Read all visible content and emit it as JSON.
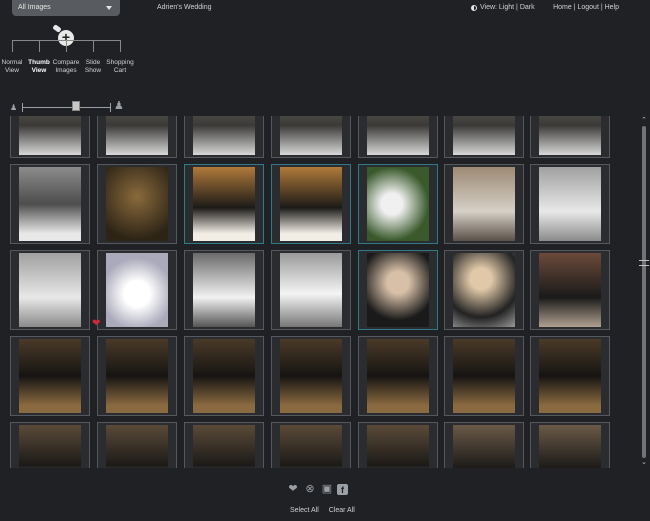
{
  "topbar": {
    "album_select": "All Images",
    "album_title": "Adrien's Wedding",
    "view_toggle": "View: Light | Dark",
    "links": "Home | Logout | Help"
  },
  "modes": [
    {
      "label": "Normal View",
      "active": false
    },
    {
      "label": "Thumb View",
      "active": true
    },
    {
      "label": "Compare Images",
      "active": false
    },
    {
      "label": "Slide Show",
      "active": false
    },
    {
      "label": "Shopping Cart",
      "active": false
    }
  ],
  "grid": {
    "rows": [
      [
        "partial",
        "partial",
        "partial",
        "partial",
        "partial",
        "partial",
        "partial"
      ],
      [
        "couple-church",
        "couple-indoor",
        "bride-bridesmaid",
        "bride-bridesmaid",
        "couple-closeup",
        "church-entrance",
        "bride-stairs"
      ],
      [
        "bride-stairs",
        "bouquet",
        "bride-bw",
        "bride-flowergirl",
        "ringbearer",
        "ringbearer-pose",
        "groom-ringbearer"
      ],
      [
        "group",
        "group",
        "group",
        "group",
        "group",
        "group",
        "group"
      ],
      [
        "couple-partial",
        "couple-partial",
        "couple-partial",
        "couple-partial",
        "couple-partial",
        "group-partial",
        "group-partial"
      ]
    ],
    "selected": [
      [
        1,
        2
      ],
      [
        1,
        3
      ],
      [
        1,
        4
      ],
      [
        2,
        4
      ]
    ]
  },
  "bottom": {
    "select_all": "Select All",
    "clear_all": "Clear All"
  }
}
